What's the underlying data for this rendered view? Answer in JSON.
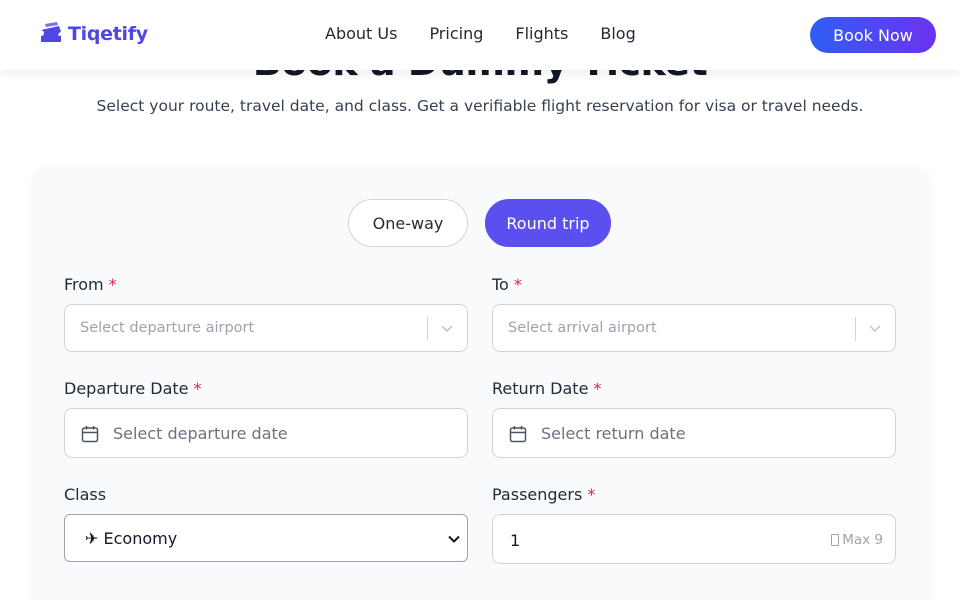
{
  "nav": {
    "brand": "Tiqetify",
    "links": [
      "About Us",
      "Pricing",
      "Flights",
      "Blog"
    ],
    "cta": "Book Now"
  },
  "hero": {
    "title": "Book a Dummy Ticket",
    "subtitle": "Select your route, travel date, and class. Get a verifiable flight reservation for visa or travel needs."
  },
  "form": {
    "trip_types": [
      "One-way",
      "Round trip"
    ],
    "selected_trip": "Round trip",
    "required_mark": "*",
    "from": {
      "label": "From",
      "placeholder": "Select departure airport"
    },
    "to": {
      "label": "To",
      "placeholder": "Select arrival airport"
    },
    "departure_date": {
      "label": "Departure Date",
      "placeholder": "Select departure date"
    },
    "return_date": {
      "label": "Return Date",
      "placeholder": "Select return date"
    },
    "class": {
      "label": "Class",
      "value": "✈ Economy"
    },
    "passengers": {
      "label": "Passengers",
      "value": "1",
      "hint": "Max 9"
    }
  },
  "colors": {
    "brand": "#4f46e5",
    "accent": "#5b4ff0",
    "required": "#e11d48"
  }
}
